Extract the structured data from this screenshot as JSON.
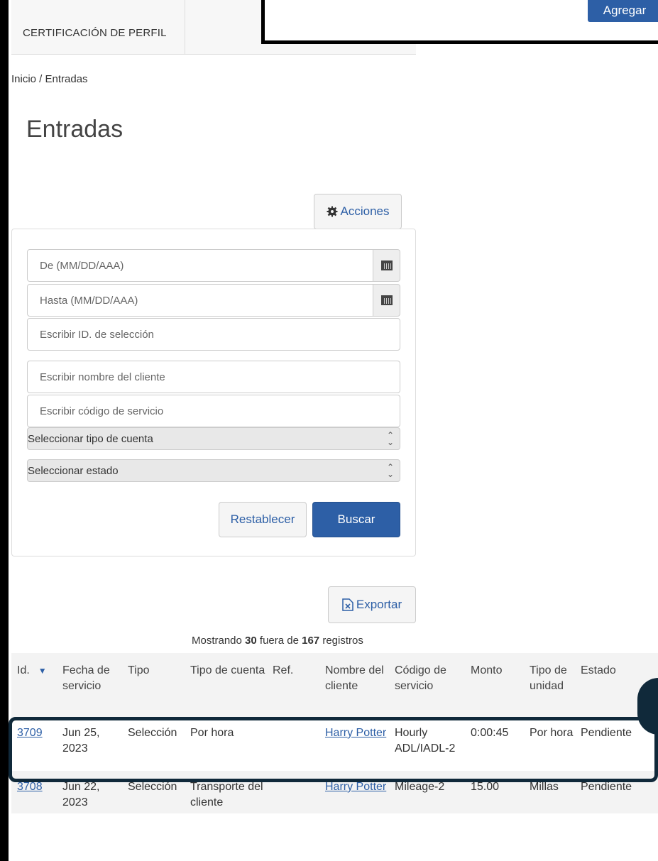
{
  "header": {
    "tab_label": "CERTIFICACIÓN DE PERFIL",
    "add_button": "Agregar"
  },
  "breadcrumb": "Inicio / Entradas",
  "page_title": "Entradas",
  "actions_button": "Acciones",
  "filters": {
    "from_placeholder": "De (MM/DD/AAA)",
    "to_placeholder": "Hasta (MM/DD/AAA)",
    "selection_id_placeholder": "Escribir ID. de selección",
    "client_name_placeholder": "Escribir nombre del cliente",
    "service_code_placeholder": "Escribir código de servicio",
    "account_type_select": "Seleccionar tipo de cuenta",
    "status_select": "Seleccionar estado",
    "reset_button": "Restablecer",
    "search_button": "Buscar"
  },
  "export_button": "Exportar",
  "records": {
    "prefix": "Mostrando",
    "shown": "30",
    "middle": "fuera de",
    "total": "167",
    "suffix": "registros"
  },
  "table": {
    "headers": [
      "Id.",
      "Fecha de servicio",
      "Tipo",
      "Tipo de cuenta",
      "Ref.",
      "Nombre del cliente",
      "Código de servicio",
      "Monto",
      "Tipo de unidad",
      "Estado"
    ],
    "rows": [
      {
        "id": "3709",
        "date": "Jun 25, 2023",
        "type": "Selección",
        "account_type": "Por hora",
        "ref": "",
        "client": "Harry Potter",
        "service_code": "Hourly ADL/IADL-2",
        "amount": "0:00:45",
        "unit_type": "Por hora",
        "status": "Pendiente"
      },
      {
        "id": "3708",
        "date": "Jun 22, 2023",
        "type": "Selección",
        "account_type": "Transporte del cliente",
        "ref": "",
        "client": "Harry Potter",
        "service_code": "Mileage-2",
        "amount": "15.00",
        "unit_type": "Millas",
        "status": "Pendiente"
      }
    ]
  },
  "colors": {
    "primary": "#2d5fa6",
    "highlight": "#10293a"
  }
}
